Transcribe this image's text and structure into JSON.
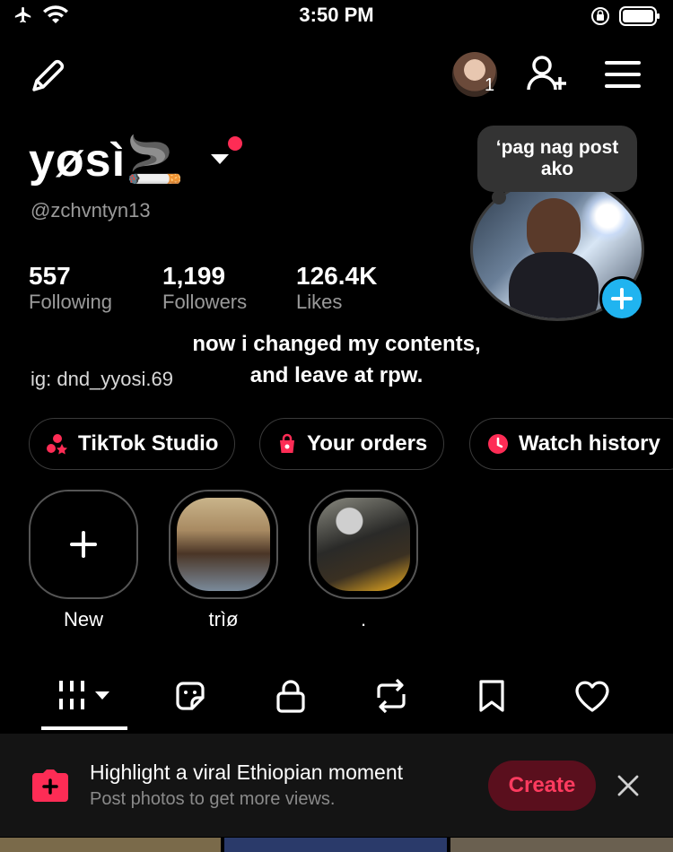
{
  "status_bar": {
    "time": "3:50 PM"
  },
  "profile": {
    "username": "yøsì🚬",
    "handle": "@zchvntyn13",
    "note_bubble": "‘pag nag post ako",
    "notification_count": "1"
  },
  "stats": [
    {
      "value": "557",
      "label": "Following"
    },
    {
      "value": "1,199",
      "label": "Followers"
    },
    {
      "value": "126.4K",
      "label": "Likes"
    }
  ],
  "bio": {
    "line1": "now i changed my contents,",
    "line2": "and leave at rpw.",
    "ig": "ig: dnd_yyosi.69"
  },
  "pills": [
    {
      "label": "TikTok Studio",
      "icon": "studio-icon",
      "color": "#ff3b7a"
    },
    {
      "label": "Your orders",
      "icon": "orders-icon",
      "color": "#ff3b7a"
    },
    {
      "label": "Watch history",
      "icon": "clock-icon",
      "color": "#ff3b7a"
    }
  ],
  "highlights": [
    {
      "label": "New",
      "icon": "plus-icon"
    },
    {
      "label": "trìø"
    },
    {
      "label": "."
    }
  ],
  "tabs": [
    "grid-icon",
    "sticker-icon",
    "lock-icon",
    "repost-icon",
    "bookmark-icon",
    "heart-icon"
  ],
  "banner": {
    "title": "Highlight a viral Ethiopian moment",
    "subtitle": "Post photos to get more views.",
    "button": "Create",
    "accent": "#ff2d55"
  },
  "colors": {
    "accent": "#fe2c55",
    "blue": "#20b4f0"
  }
}
